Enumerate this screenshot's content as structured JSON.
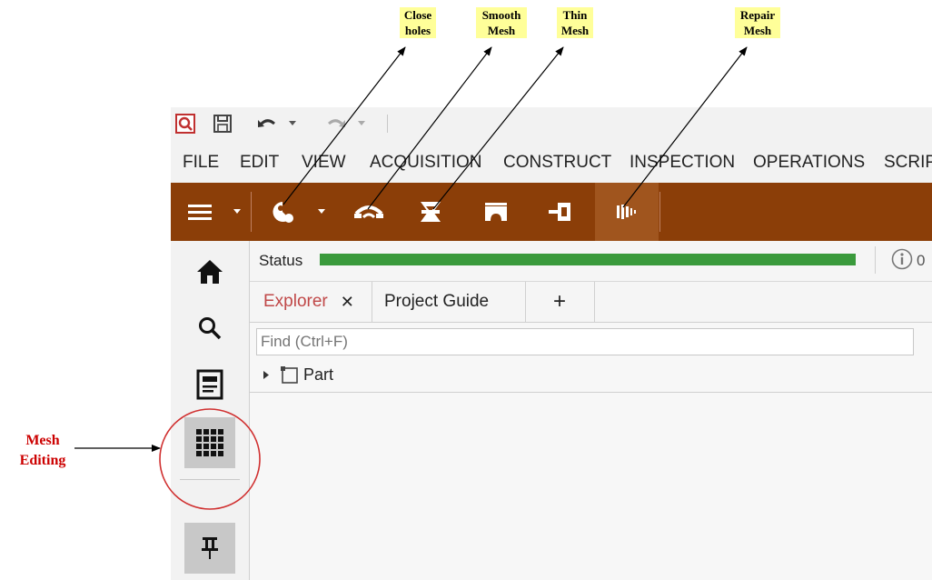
{
  "callouts": {
    "close_holes": "Close\nholes",
    "smooth_mesh": "Smooth\nMesh",
    "thin_mesh": "Thin\nMesh",
    "repair_mesh": "Repair\nMesh"
  },
  "side_label": "Mesh\nEditing",
  "menu": [
    "FILE",
    "EDIT",
    "VIEW",
    "ACQUISITION",
    "CONSTRUCT",
    "INSPECTION",
    "OPERATIONS",
    "SCRIPTING"
  ],
  "status": {
    "label": "Status",
    "progress": 1.0,
    "count": "0"
  },
  "tabs": {
    "explorer": "Explorer",
    "close_symbol": "✕",
    "project_guide": "Project Guide",
    "add_symbol": "+"
  },
  "find": {
    "placeholder": "Find (Ctrl+F)"
  },
  "tree": {
    "root_label": "Part"
  },
  "colors": {
    "toolbar": "#8b3e08",
    "progress": "#3a9a3c",
    "accent_red": "#cc0000",
    "callout_bg": "#ffff99"
  },
  "icons": {
    "qat": [
      "app-logo-icon",
      "save-icon",
      "undo-icon",
      "redo-icon"
    ],
    "toolbar": [
      "hamburger-menu-icon",
      "close-holes-icon",
      "smooth-mesh-icon",
      "thin-mesh-icon",
      "bridge-icon",
      "extend-icon",
      "repair-mesh-icon"
    ],
    "sidebar": [
      "home-icon",
      "search-icon",
      "document-icon",
      "mesh-grid-icon",
      "pin-icon"
    ]
  }
}
